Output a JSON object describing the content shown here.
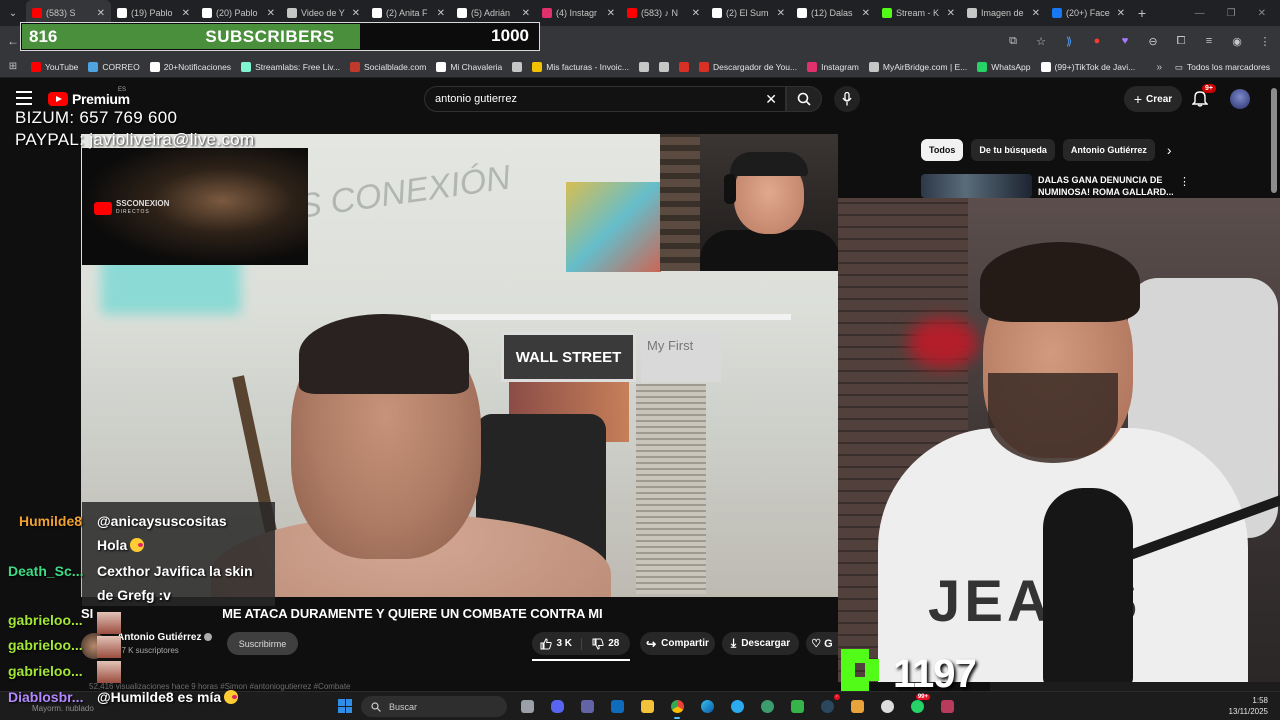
{
  "browser": {
    "tabs": [
      {
        "title": "(583) S",
        "icon": "youtube-icon",
        "color": "#ff0000",
        "active": true
      },
      {
        "title": "(19) Pablo",
        "icon": "x-icon",
        "color": "#ffffff",
        "active": false
      },
      {
        "title": "(20) Pablo",
        "icon": "x-icon",
        "color": "#ffffff",
        "active": false
      },
      {
        "title": "Video de Y",
        "icon": "globe-icon",
        "color": "#c4c7c5",
        "active": false
      },
      {
        "title": "(2) Anita F",
        "icon": "x-icon",
        "color": "#ffffff",
        "active": false
      },
      {
        "title": "(5) Adrián",
        "icon": "x-icon",
        "color": "#ffffff",
        "active": false
      },
      {
        "title": "(4) Instagr",
        "icon": "instagram-icon",
        "color": "#e1306c",
        "active": false
      },
      {
        "title": "(583) ♪ N",
        "icon": "youtube-icon",
        "color": "#ff0000",
        "active": false
      },
      {
        "title": "(2) El Sum",
        "icon": "x-icon",
        "color": "#ffffff",
        "active": false
      },
      {
        "title": "(12) Dalas",
        "icon": "x-icon",
        "color": "#ffffff",
        "active": false
      },
      {
        "title": "Stream - K",
        "icon": "kick-icon",
        "color": "#53fc18",
        "active": false
      },
      {
        "title": "Imagen de",
        "icon": "globe-icon",
        "color": "#c4c7c5",
        "active": false
      },
      {
        "title": "(20+) Face",
        "icon": "facebook-icon",
        "color": "#1877f2",
        "active": false
      }
    ],
    "bookmarks": [
      {
        "label": "YouTube",
        "icon": "youtube-icon",
        "color": "#ff0000"
      },
      {
        "label": "CORREO",
        "icon": "mail-icon",
        "color": "#4fa3e0"
      },
      {
        "label": "20+Notificaciones",
        "icon": "x-icon",
        "color": "#ffffff"
      },
      {
        "label": "Streamlabs: Free Liv...",
        "icon": "streamlabs-icon",
        "color": "#80f5d2"
      },
      {
        "label": "Socialblade.com",
        "icon": "socialblade-icon",
        "color": "#c0392b"
      },
      {
        "label": "Mi Chavaleria",
        "icon": "notion-icon",
        "color": "#ffffff"
      },
      {
        "label": "",
        "icon": "globe-icon",
        "color": "#c4c7c5"
      },
      {
        "label": "Mis facturas - Invoic...",
        "icon": "invoice-icon",
        "color": "#f2c200"
      },
      {
        "label": "",
        "icon": "globe-icon",
        "color": "#c4c7c5"
      },
      {
        "label": "",
        "icon": "globe-icon",
        "color": "#c4c7c5"
      },
      {
        "label": "",
        "icon": "red-icon",
        "color": "#d93025"
      },
      {
        "label": "Descargador de You...",
        "icon": "download-icon",
        "color": "#d93025"
      },
      {
        "label": "Instagram",
        "icon": "instagram-icon",
        "color": "#e1306c"
      },
      {
        "label": "MyAirBridge.com | E...",
        "icon": "cloud-icon",
        "color": "#c4c7c5"
      },
      {
        "label": "WhatsApp",
        "icon": "whatsapp-icon",
        "color": "#25d366"
      },
      {
        "label": "(99+)TikTok de Javi...",
        "icon": "tiktok-icon",
        "color": "#ffffff"
      }
    ],
    "bookmarks_more": "»",
    "all_bookmarks": "Todos los marcadores"
  },
  "subscriber_goal": {
    "current": "816",
    "label": "SUBSCRIBERS",
    "goal": "1000",
    "progress": 0.816,
    "color": "#4a8f3c"
  },
  "youtube": {
    "logo_text": "Premium",
    "country": "ES",
    "search_value": "antonio gutierrez",
    "create_label": "Crear",
    "notifications": "9+",
    "chips": [
      "Todos",
      "De tu búsqueda",
      "Antonio Gutiérrez"
    ],
    "recommended_title": "DALAS GANA DENUNCIA DE NUMINOSA! ROMA GALLARD...",
    "video_title_visible": "ME ATACA DURAMENTE Y QUIERE UN COMBATE CONTRA MI",
    "video_title_prefix": "SI",
    "channel_name": "Antonio Gutiérrez",
    "channel_subs": "57 K suscriptores",
    "subscribe_label": "Suscribirme",
    "likes": "3 K",
    "dislikes": "28",
    "share_label": "Compartir",
    "download_label": "Descargar",
    "views_line": "52,416 visualizaciones  hace 9 horas  #Simon #antoniogutierrez #Combate",
    "poster_text": "WALL STREET",
    "poster2_text": "My First",
    "inset_brand": "SSCONEXION",
    "inset_brand_sub": "DIRECTOS"
  },
  "overlay": {
    "bizum": "BIZUM: 657 769 600",
    "paypal": "PAYPAL: javioliveira@live.com"
  },
  "chat": [
    {
      "user": "Humilde8",
      "color": "#f0a030",
      "message": "@anicaysuscositas"
    },
    {
      "user": "",
      "color": "#ffffff",
      "message": "Hola"
    },
    {
      "user": "Death_Sc...",
      "color": "#3ddc84",
      "message": "Cexthor Javifica la skin"
    },
    {
      "user": "",
      "color": "#ffffff",
      "message": "de Grefg :v"
    },
    {
      "user": "gabrieloo...",
      "color": "#a3e635",
      "message": ""
    },
    {
      "user": "gabrieloo...",
      "color": "#a3e635",
      "message": ""
    },
    {
      "user": "gabrieloo...",
      "color": "#a3e635",
      "message": ""
    },
    {
      "user": "Diablosbr...",
      "color": "#b388ff",
      "message": "@Humilde8 es mía"
    }
  ],
  "kick": {
    "viewers": "1197",
    "color": "#53fc18"
  },
  "taskbar": {
    "weather": "Mayorm. nublado",
    "search_label": "Buscar",
    "time": "1:58",
    "date": "13/11/2025",
    "badge_steam": "99+"
  }
}
